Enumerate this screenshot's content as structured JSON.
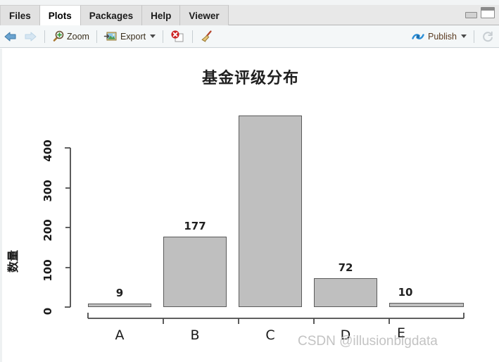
{
  "window": {
    "minimize_title": "Minimize",
    "maximize_title": "Maximize"
  },
  "tabs": [
    {
      "label": "Files",
      "active": false
    },
    {
      "label": "Plots",
      "active": true
    },
    {
      "label": "Packages",
      "active": false
    },
    {
      "label": "Help",
      "active": false
    },
    {
      "label": "Viewer",
      "active": false
    }
  ],
  "toolbar": {
    "back_icon": "back-arrow-icon",
    "forward_icon": "forward-arrow-icon",
    "zoom_label": "Zoom",
    "zoom_icon": "magnifier-plus-icon",
    "export_label": "Export",
    "export_icon": "export-image-icon",
    "remove_icon": "remove-plot-icon",
    "clear_icon": "broom-clear-all-icon",
    "publish_label": "Publish",
    "publish_icon": "publish-icon",
    "refresh_icon": "refresh-icon"
  },
  "watermark": "CSDN @illusionbigdata",
  "chart_data": {
    "type": "bar",
    "title": "基金评级分布",
    "xlabel": "",
    "ylabel": "数量",
    "categories": [
      "A",
      "B",
      "C",
      "D",
      "E"
    ],
    "values": [
      9,
      177,
      482,
      72,
      10
    ],
    "labels": [
      "9",
      "177",
      "",
      "72",
      "10"
    ],
    "ylim": [
      0,
      482
    ],
    "yticks": [
      0,
      100,
      200,
      300,
      400
    ],
    "ytick_labels": [
      "0",
      "100",
      "200",
      "300",
      "400"
    ],
    "grid": false,
    "legend": false,
    "bar_fill": "#bfbfbf",
    "bar_border": "#5b5b5b",
    "note": "Bar C exceeds the plotted panel; its value label is clipped above the visible area."
  }
}
